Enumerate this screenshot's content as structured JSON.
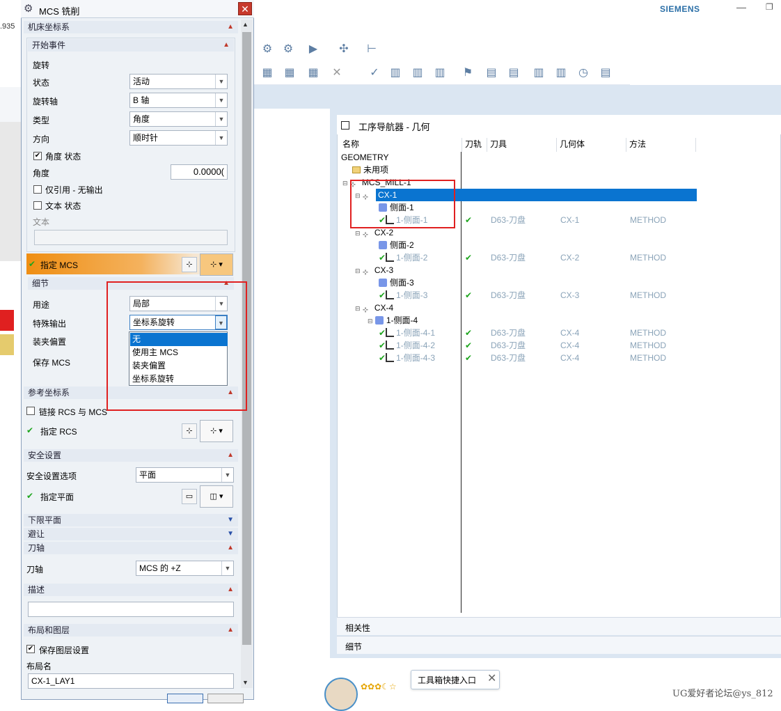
{
  "app": {
    "brand": "SIEMENS",
    "left_number": ".935"
  },
  "dialog": {
    "title": "MCS 铣削",
    "close_symbol": "✕",
    "sections": {
      "machine_cs": "机床坐标系",
      "start_event": "开始事件",
      "details": "细节",
      "reference_cs": "参考坐标系",
      "safety": "安全设置",
      "lower_plane": "下限平面",
      "avoid": "避让",
      "tool_axis": "刀轴",
      "description": "描述",
      "layout_layers": "布局和图层"
    },
    "rotation_label": "旋转",
    "state_label": "状态",
    "state_value": "活动",
    "rot_axis_label": "旋转轴",
    "rot_axis_value": "B 轴",
    "type_label": "类型",
    "type_value": "角度",
    "direction_label": "方向",
    "direction_value": "顺时针",
    "angle_state_label": "角度 状态",
    "angle_label": "角度",
    "angle_value": "0.0000(",
    "ref_only_label": "仅引用 - 无输出",
    "text_state_label": "文本 状态",
    "text_label": "文本",
    "specify_mcs_label": "指定 MCS",
    "purpose_label": "用途",
    "purpose_value": "局部",
    "special_output_label": "特殊输出",
    "special_output_value": "坐标系旋转",
    "fixture_offset_label": "装夹偏置",
    "save_mcs_label": "保存 MCS",
    "dropdown_options": [
      "无",
      "使用主 MCS",
      "装夹偏置",
      "坐标系旋转"
    ],
    "link_rcs_label": "链接 RCS 与 MCS",
    "specify_rcs_label": "指定 RCS",
    "safety_option_label": "安全设置选项",
    "safety_option_value": "平面",
    "specify_plane_label": "指定平面",
    "tool_axis_label": "刀轴",
    "tool_axis_value": "MCS 的 +Z",
    "save_layers_label": "保存图层设置",
    "layout_name_label": "布局名",
    "layout_name_value": "CX-1_LAY1"
  },
  "navigator": {
    "title": "工序导航器 - 几何",
    "columns": [
      "名称",
      "刀轨",
      "刀具",
      "几何体",
      "方法"
    ],
    "rows": [
      {
        "name": "GEOMETRY",
        "kind": "root"
      },
      {
        "name": "未用项",
        "kind": "folder"
      },
      {
        "name": "MCS_MILL-1",
        "kind": "mcs"
      },
      {
        "name": "CX-1",
        "kind": "mcs",
        "selected": true
      },
      {
        "name": "侧面-1",
        "kind": "geom"
      },
      {
        "name": "1-侧面-1",
        "kind": "op",
        "tool": "D63-刀盘",
        "geometry": "CX-1",
        "method": "METHOD"
      },
      {
        "name": "CX-2",
        "kind": "mcs"
      },
      {
        "name": "侧面-2",
        "kind": "geom"
      },
      {
        "name": "1-侧面-2",
        "kind": "op",
        "tool": "D63-刀盘",
        "geometry": "CX-2",
        "method": "METHOD"
      },
      {
        "name": "CX-3",
        "kind": "mcs"
      },
      {
        "name": "侧面-3",
        "kind": "geom"
      },
      {
        "name": "1-侧面-3",
        "kind": "op",
        "tool": "D63-刀盘",
        "geometry": "CX-3",
        "method": "METHOD"
      },
      {
        "name": "CX-4",
        "kind": "mcs"
      },
      {
        "name": "1-侧面-4",
        "kind": "geom"
      },
      {
        "name": "1-侧面-4-1",
        "kind": "op",
        "tool": "D63-刀盘",
        "geometry": "CX-4",
        "method": "METHOD"
      },
      {
        "name": "1-侧面-4-2",
        "kind": "op",
        "tool": "D63-刀盘",
        "geometry": "CX-4",
        "method": "METHOD"
      },
      {
        "name": "1-侧面-4-3",
        "kind": "op",
        "tool": "D63-刀盘",
        "geometry": "CX-4",
        "method": "METHOD"
      }
    ],
    "bottom_panels": [
      "相关性",
      "细节"
    ]
  },
  "overlay": {
    "tooltip": "工具箱快捷入口",
    "watermark": "UG爱好者论坛@ys_812"
  },
  "colors": {
    "selection_blue": "#0a74d0",
    "highlight_red": "#e02020",
    "check_green": "#1ea51e",
    "orange": "#ef8e13"
  }
}
